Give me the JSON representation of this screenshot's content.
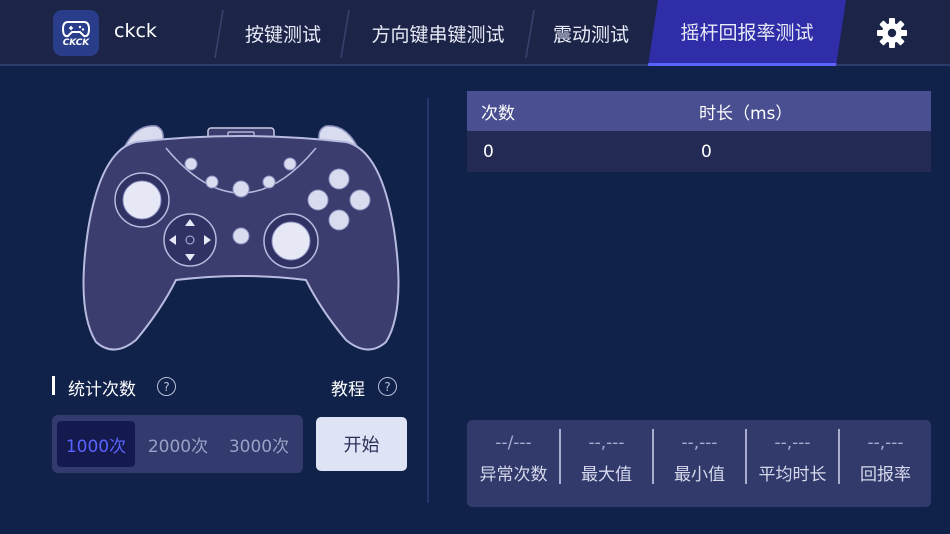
{
  "app": {
    "name": "ckck",
    "logo_text": "CKCK"
  },
  "tabs": [
    {
      "label": "按键测试"
    },
    {
      "label": "方向键串键测试"
    },
    {
      "label": "震动测试"
    },
    {
      "label": "摇杆回报率测试"
    }
  ],
  "active_tab": "摇杆回报率测试",
  "settings": {
    "icon": "gear-icon"
  },
  "stats_section": {
    "title": "统计次数",
    "help": "?",
    "tutorial_label": "教程",
    "tutorial_help": "?"
  },
  "count_options": [
    "1000次",
    "2000次",
    "3000次"
  ],
  "selected_count": "1000次",
  "start_label": "开始",
  "table": {
    "headers": [
      "次数",
      "时长（ms）"
    ],
    "rows": [
      [
        "0",
        "0"
      ]
    ]
  },
  "stats": [
    {
      "value": "--/---",
      "label": "异常次数"
    },
    {
      "value": "--,---",
      "label": "最大值"
    },
    {
      "value": "--,---",
      "label": "最小值"
    },
    {
      "value": "--,---",
      "label": "平均时长"
    },
    {
      "value": "--,---",
      "label": "回报率"
    }
  ],
  "colors": {
    "background": "#10214a",
    "topbar": "#1c2548",
    "active_tab": "#2f2da8",
    "accent": "#5a63ff",
    "table_header": "#4a4f91",
    "controller_fill": "#3a3d6e"
  }
}
